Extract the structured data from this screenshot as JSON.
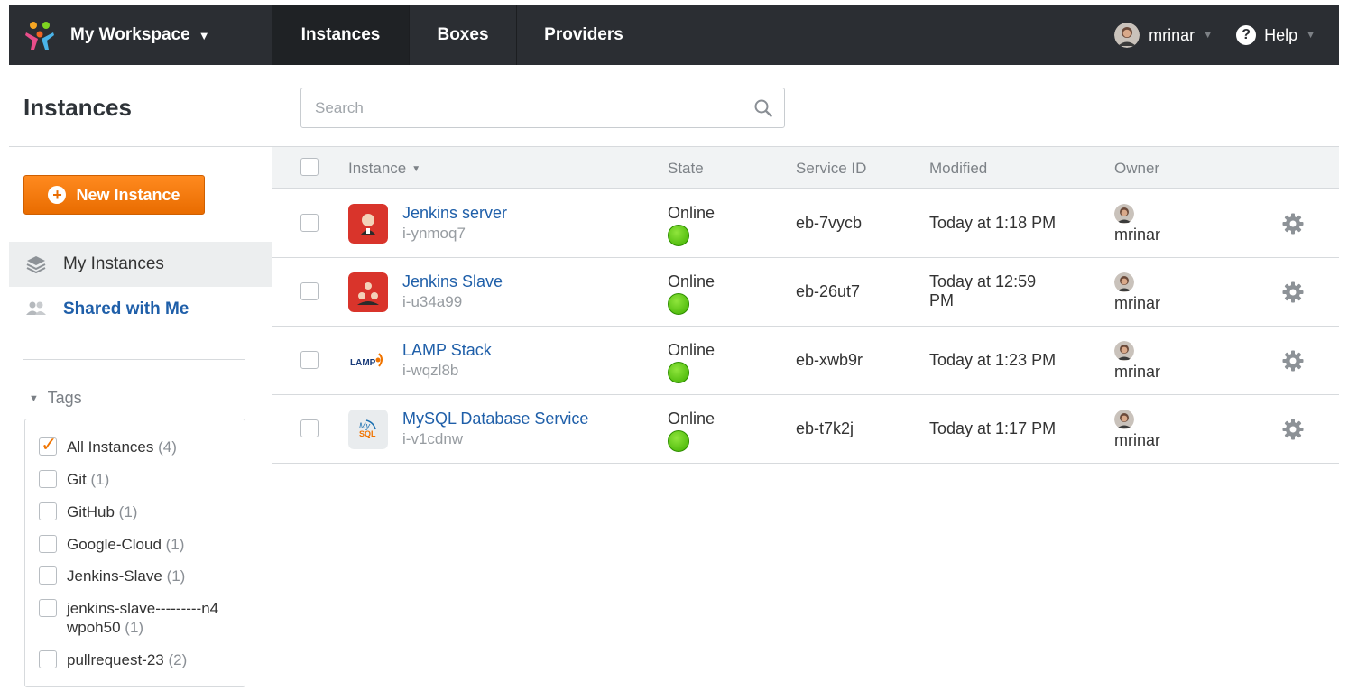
{
  "navbar": {
    "workspace_label": "My Workspace",
    "workspace_caret": "▼",
    "tabs": [
      "Instances",
      "Boxes",
      "Providers"
    ],
    "user_name": "mrinar",
    "user_caret": "▼",
    "help_label": "Help",
    "help_glyph": "?",
    "help_caret": "▼"
  },
  "page": {
    "title": "Instances",
    "search_placeholder": "Search"
  },
  "sidebar": {
    "new_button_label": "New Instance",
    "new_button_glyph": "+",
    "nav": [
      "My Instances",
      "Shared with Me"
    ],
    "tags_title": "Tags",
    "tags_toggle": "▼",
    "tags": [
      {
        "label": "All Instances",
        "count": "(4)",
        "checked": true
      },
      {
        "label": "Git",
        "count": "(1)",
        "checked": false
      },
      {
        "label": "GitHub",
        "count": "(1)",
        "checked": false
      },
      {
        "label": "Google-Cloud",
        "count": "(1)",
        "checked": false
      },
      {
        "label": "Jenkins-Slave",
        "count": "(1)",
        "checked": false
      },
      {
        "label": "jenkins-slave---------n4wpoh50",
        "count": "(1)",
        "checked": false
      },
      {
        "label": "pullrequest-23",
        "count": "(2)",
        "checked": false
      }
    ]
  },
  "table": {
    "headers": {
      "instance": "Instance",
      "sort_indicator": "▼",
      "state": "State",
      "service_id": "Service ID",
      "modified": "Modified",
      "owner": "Owner"
    },
    "rows": [
      {
        "name": "Jenkins server",
        "id": "i-ynmoq7",
        "icon": "jenkins-icon",
        "state": "Online",
        "service_id": "eb-7vycb",
        "modified": "Today at 1:18 PM",
        "owner": "mrinar"
      },
      {
        "name": "Jenkins Slave",
        "id": "i-u34a99",
        "icon": "jenkins-slave-icon",
        "state": "Online",
        "service_id": "eb-26ut7",
        "modified": "Today at 12:59 PM",
        "owner": "mrinar"
      },
      {
        "name": "LAMP Stack",
        "id": "i-wqzl8b",
        "icon": "lamp-icon",
        "state": "Online",
        "service_id": "eb-xwb9r",
        "modified": "Today at 1:23 PM",
        "owner": "mrinar"
      },
      {
        "name": "MySQL Database Service",
        "id": "i-v1cdnw",
        "icon": "mysql-icon",
        "state": "Online",
        "service_id": "eb-t7k2j",
        "modified": "Today at 1:17 PM",
        "owner": "mrinar"
      }
    ]
  },
  "colors": {
    "navbar": "#2b2e33",
    "accent_orange": "#f07400",
    "link_blue": "#1f5fa9",
    "online_green": "#3fb000"
  },
  "icons": {
    "logo": "workspace-logo-icon",
    "search": "search-icon",
    "my_instances": "layers-icon",
    "shared": "users-icon",
    "settings": "gear-icon"
  },
  "logo_text": {
    "lamp": "LAMP",
    "mysql": "My SQL"
  }
}
